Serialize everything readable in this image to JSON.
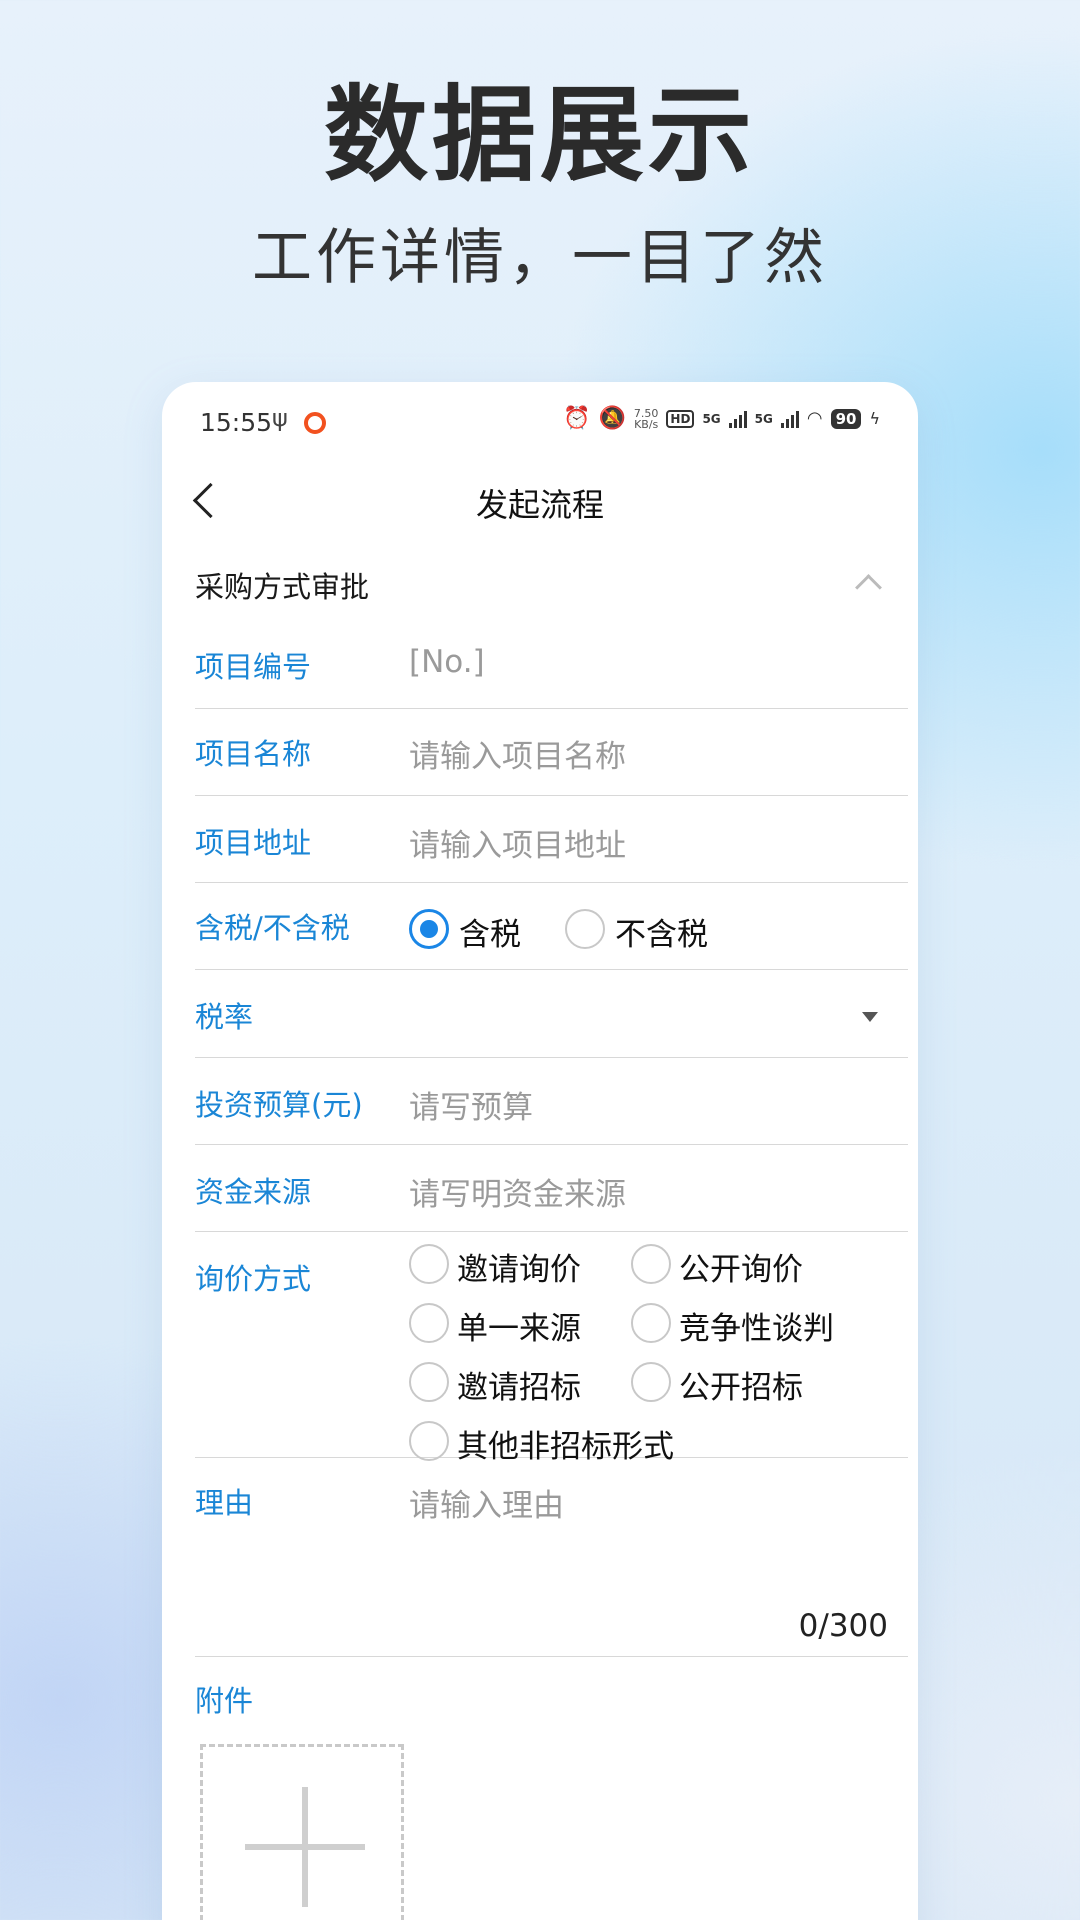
{
  "promo": {
    "headline": "数据展示",
    "subline": "工作详情，一目了然"
  },
  "status_bar": {
    "time": "15:55",
    "net_speed_value": "7.50",
    "net_speed_unit": "KB/s",
    "hd_badge": "HD",
    "signal1": "5G",
    "signal2": "5G",
    "battery": "90"
  },
  "nav": {
    "title": "发起流程"
  },
  "section": {
    "title": "采购方式审批"
  },
  "form": {
    "project_no": {
      "label": "项目编号",
      "value": "[No.]"
    },
    "project_name": {
      "label": "项目名称",
      "placeholder": "请输入项目名称"
    },
    "project_address": {
      "label": "项目地址",
      "placeholder": "请输入项目地址"
    },
    "tax_type": {
      "label": "含税/不含税",
      "options": [
        "含税",
        "不含税"
      ],
      "selected": "含税"
    },
    "tax_rate": {
      "label": "税率",
      "value": ""
    },
    "budget": {
      "label": "投资预算(元)",
      "placeholder": "请写预算"
    },
    "fund_source": {
      "label": "资金来源",
      "placeholder": "请写明资金来源"
    },
    "inquiry": {
      "label": "询价方式",
      "options": [
        "邀请询价",
        "公开询价",
        "单一来源",
        "竞争性谈判",
        "邀请招标",
        "公开招标",
        "其他非招标形式"
      ],
      "selected": ""
    },
    "reason": {
      "label": "理由",
      "placeholder": "请输入理由",
      "counter": "0/300"
    },
    "attachment": {
      "label": "附件"
    }
  },
  "colors": {
    "label_blue": "#1a86d6",
    "radio_blue": "#1a86e6"
  }
}
